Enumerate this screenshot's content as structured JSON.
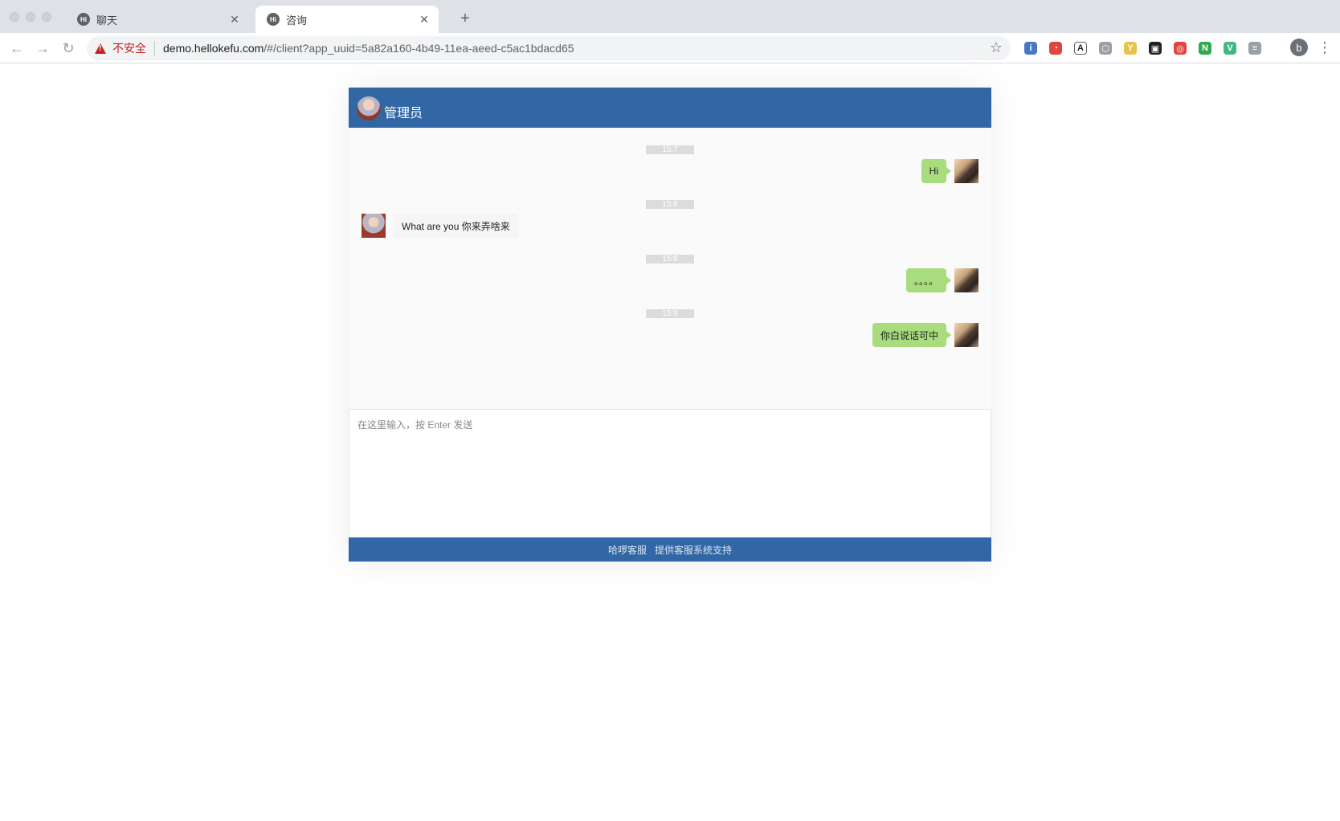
{
  "browser": {
    "tabs": [
      {
        "title": "聊天",
        "active": false,
        "favicon": "Hi"
      },
      {
        "title": "咨询",
        "active": true,
        "favicon": "Hi"
      }
    ],
    "new_tab": "+",
    "security_label": "不安全",
    "url_host": "demo.hellokefu.com",
    "url_path": "/#/client?app_uuid=5a82a160-4b49-11ea-aeed-c5ac1bdacd65",
    "profile_initial": "b",
    "extensions": [
      {
        "name": "ext-blue-icon",
        "color": "#4a76c9",
        "glyph": "i"
      },
      {
        "name": "ext-red-icon",
        "color": "#e0443e",
        "glyph": "◔"
      },
      {
        "name": "ext-a-icon",
        "color": "#ffffff",
        "glyph": "A"
      },
      {
        "name": "ext-hex-icon",
        "color": "#9aa0a6",
        "glyph": "⬡"
      },
      {
        "name": "ext-y-icon",
        "color": "#e8c34a",
        "glyph": "Y"
      },
      {
        "name": "ext-dark-icon",
        "color": "#202124",
        "glyph": "▣"
      },
      {
        "name": "ext-target-icon",
        "color": "#e0443e",
        "glyph": "◎"
      },
      {
        "name": "ext-green-n-icon",
        "color": "#2fa84f",
        "glyph": "N"
      },
      {
        "name": "ext-vue-icon",
        "color": "#41b883",
        "glyph": "V"
      },
      {
        "name": "ext-list-icon",
        "color": "#9aa0a6",
        "glyph": "≡"
      }
    ]
  },
  "chat": {
    "header_title": "管理员",
    "messages": [
      {
        "time": "15:7",
        "from": "self",
        "text": "Hi"
      },
      {
        "time": "15:8",
        "from": "agent",
        "text": "What are you 你来弄啥来"
      },
      {
        "time": "15:8",
        "from": "self",
        "text": "。。。。"
      },
      {
        "time": "15:9",
        "from": "self",
        "text": "你白说话可中"
      }
    ],
    "input_placeholder": "在这里输入，按 Enter 发送",
    "footer_brand": "哈啰客服",
    "footer_tagline": "提供客服系统支持"
  },
  "colors": {
    "header_bg": "#3167a5",
    "self_bubble": "#a9dc7c",
    "insecure_red": "#c5221f"
  }
}
